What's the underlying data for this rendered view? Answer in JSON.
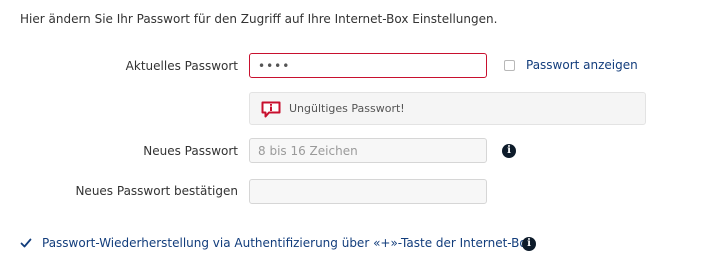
{
  "intro_text": "Hier ändern Sie Ihr Passwort für den Zugriff auf Ihre Internet-Box Einstellungen.",
  "current_password": {
    "label": "Aktuelles Passwort",
    "value": "••••",
    "show_password_label": "Passwort anzeigen",
    "show_password_checked": false
  },
  "error": {
    "message": "Ungültiges Passwort!",
    "icon": "speech-bubble-info-icon"
  },
  "new_password": {
    "label": "Neues Passwort",
    "placeholder": "8 bis 16 Zeichen",
    "info_icon": "info-icon"
  },
  "confirm_password": {
    "label": "Neues Passwort bestätigen",
    "value": ""
  },
  "recovery": {
    "label": "Passwort-Wiederherstellung via Authentifizierung über «+»-Taste der Internet-Box",
    "checked": true,
    "info_icon": "info-icon"
  },
  "colors": {
    "error_red": "#c8102e",
    "link_blue": "#123d7c",
    "info_dark": "#0d1b2a"
  }
}
